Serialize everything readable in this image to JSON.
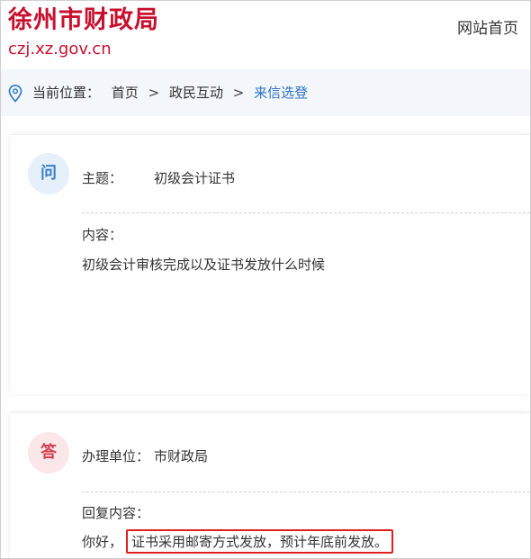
{
  "header": {
    "title": "徐州市财政局",
    "domain": "czj.xz.gov.cn",
    "home_link": "网站首页"
  },
  "breadcrumb": {
    "icon": "location-pin-icon",
    "prefix": "当前位置：",
    "items": [
      "首页",
      "政民互动",
      "来信选登"
    ],
    "separator": ">"
  },
  "question": {
    "badge": "问",
    "subject_label": "主题：",
    "subject_value": "初级会计证书",
    "content_label": "内容：",
    "content_value": "初级会计审核完成以及证书发放什么时候"
  },
  "answer": {
    "badge": "答",
    "unit_label": "办理单位：",
    "unit_value": "市财政局",
    "reply_label": "回复内容：",
    "reply_greeting": "你好，",
    "reply_text": "证书采用邮寄方式发放，预计年底前发放。"
  },
  "colors": {
    "brand_red": "#c8102e",
    "link_blue": "#2d73c3",
    "highlight_border": "#e02020"
  }
}
